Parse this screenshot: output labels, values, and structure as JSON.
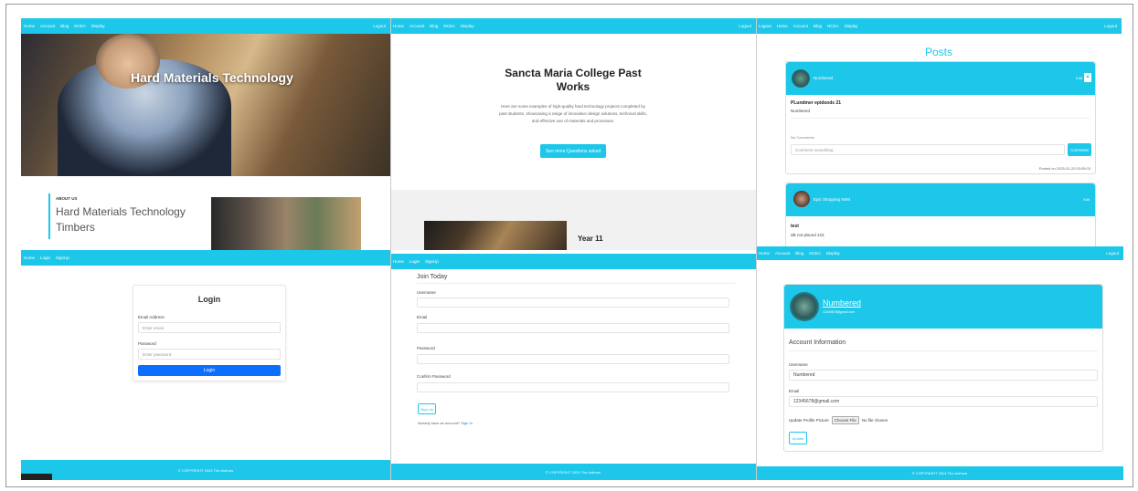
{
  "nav": {
    "home": "Home",
    "account": "Account",
    "blog": "Blog",
    "ncea": "NCEA",
    "display": "Display",
    "logout": "Logout",
    "login": "Login",
    "signup": "SignUp"
  },
  "p1": {
    "hero_title": "Hard Materials Technology",
    "about_tag": "ABOUT US",
    "about_title_1": "Hard Materials Technology",
    "about_title_2": "Timbers"
  },
  "p2": {
    "title_1": "Sancta Maria College Past",
    "title_2": "Works",
    "desc": "Here are some examples of high-quality hard technology projects completed by past students, showcasing a range of innovative design solutions, technical skills, and effective use of materials and processes.",
    "button": "See more Questions asked",
    "section": "Year 11"
  },
  "p3": {
    "heading": "Posts",
    "post1": {
      "user": "Numbered",
      "badge": "Edit",
      "title": "PLundmer epidsods 21",
      "sub": "Numbered",
      "comments_label": "No Comments",
      "comment_placeholder": "Comment something",
      "comment_button": "Comment",
      "posted": "Posted on 2025-01-20 03:05:03"
    },
    "post2": {
      "user": "Epic Shopping 9494",
      "badge": "Edit",
      "title": "test",
      "sub": "idk not placed 123"
    }
  },
  "p4": {
    "title": "Login",
    "email_label": "Email Address",
    "email_placeholder": "Enter email",
    "password_label": "Password",
    "password_placeholder": "Enter password",
    "button": "Login",
    "footer": "© COPYRIGHT 2024 The Authors"
  },
  "p5": {
    "title": "Join Today",
    "username_label": "Username",
    "email_label": "Email",
    "password_label": "Password",
    "confirm_label": "Confirm Password",
    "button": "Sign Up",
    "already": "Already have an account?",
    "signin": "Sign In",
    "footer": "© COPYRIGHT 2024 The Authors"
  },
  "p6": {
    "name": "Numbered",
    "email_small": "12345678@gmail.com",
    "section": "Account Information",
    "username_label": "Username",
    "username_value": "Numbered",
    "email_label": "Email",
    "email_value": "12345678@gmail.com",
    "picture_label": "Update Profile Picture",
    "choose": "Choose File",
    "nofile": "No file chosen",
    "button": "Update",
    "footer": "© COPYRIGHT 2024 The Authors"
  },
  "colors": {
    "accent": "#1cc7ea",
    "primary": "#0d6efd"
  }
}
